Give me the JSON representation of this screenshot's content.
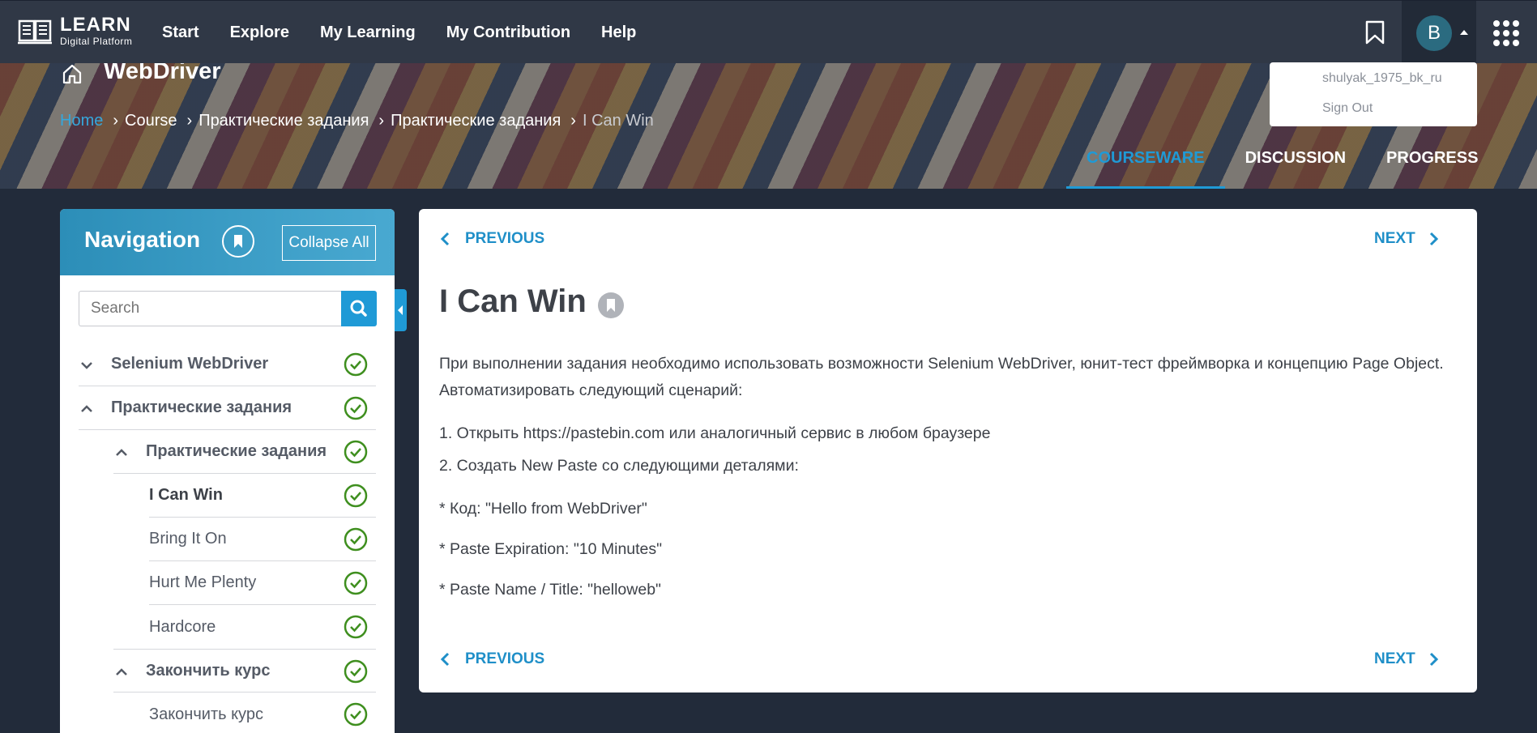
{
  "app": {
    "logo_line1": "LEARN",
    "logo_line2": "Digital Platform",
    "menu": [
      "Start",
      "Explore",
      "My Learning",
      "My Contribution",
      "Help"
    ],
    "avatar_letter": "B"
  },
  "user_menu": {
    "username": "shulyak_1975_bk_ru",
    "sign_out": "Sign Out"
  },
  "course": {
    "title": "WebDriver",
    "breadcrumb": [
      "Home",
      "Course",
      "Практические задания",
      "Практические задания",
      "I Can Win"
    ],
    "tabs": [
      "COURSEWARE",
      "DISCUSSION",
      "PROGRESS"
    ],
    "active_tab": "COURSEWARE"
  },
  "sidebar": {
    "title": "Navigation",
    "collapse_label": "Collapse All",
    "search_placeholder": "Search",
    "items": [
      {
        "label": "Selenium WebDriver",
        "level": 0,
        "expanded": false,
        "done": true
      },
      {
        "label": "Практические задания",
        "level": 0,
        "expanded": true,
        "done": true
      },
      {
        "label": "Практические задания",
        "level": 1,
        "expanded": true,
        "done": true
      },
      {
        "label": "I Can Win",
        "level": 2,
        "current": true,
        "done": true
      },
      {
        "label": "Bring It On",
        "level": 2,
        "done": true
      },
      {
        "label": "Hurt Me Plenty",
        "level": 2,
        "done": true
      },
      {
        "label": "Hardcore",
        "level": 2,
        "done": true
      },
      {
        "label": "Закончить курс",
        "level": 1,
        "expanded": true,
        "done": true
      },
      {
        "label": "Закончить курс",
        "level": 2,
        "done": true
      }
    ]
  },
  "unit": {
    "previous": "PREVIOUS",
    "next": "NEXT",
    "title": "I Can Win",
    "paragraph": "При выполнении задания необходимо использовать возможности Selenium WebDriver, юнит-тест фреймворка и концепцию Page Object. Автоматизировать следующий сценарий:",
    "steps": [
      "1. Открыть https://pastebin.com или аналогичный сервис в любом браузере",
      "2. Создать New Paste со следующими деталями:"
    ],
    "details": [
      "* Код: \"Hello from WebDriver\"",
      "* Paste Expiration: \"10 Minutes\"",
      "* Paste Name / Title: \"helloweb\""
    ]
  },
  "colors": {
    "accent": "#1f9ad6",
    "done_check": "#3f8f1f",
    "nav_bg": "#303846"
  }
}
